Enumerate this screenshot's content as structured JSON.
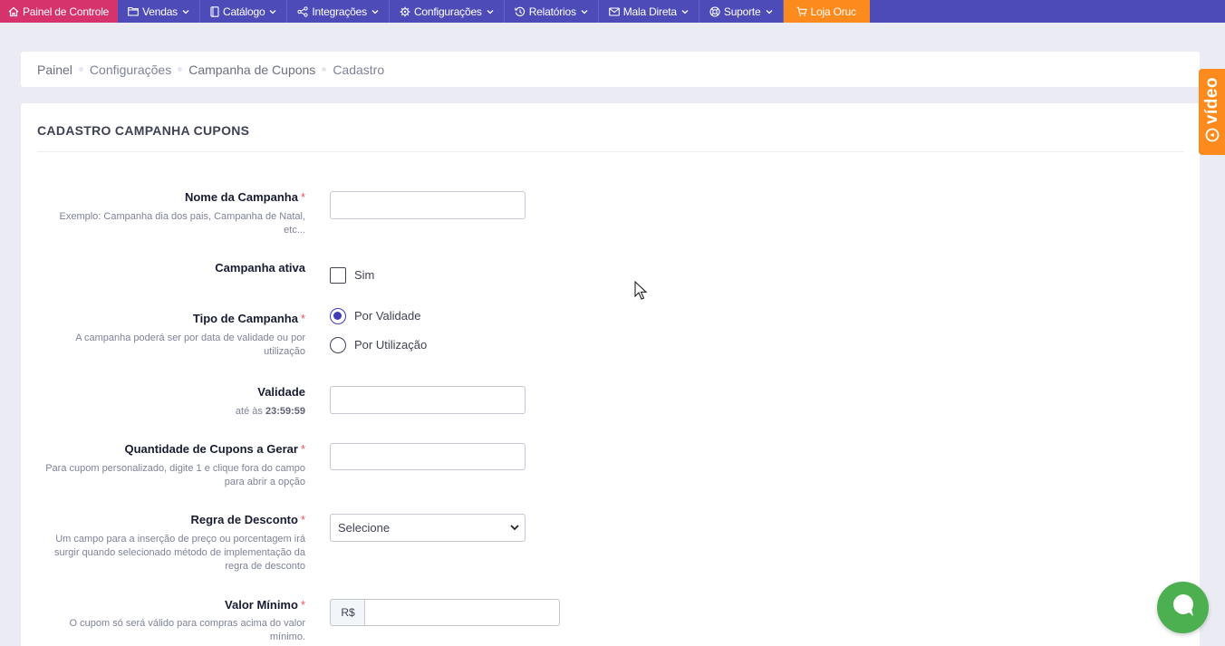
{
  "nav": {
    "items": [
      {
        "label": "Painel de Controle",
        "icon": "home-icon",
        "dropdown": false
      },
      {
        "label": "Vendas",
        "icon": "folder-icon",
        "dropdown": true
      },
      {
        "label": "Catálogo",
        "icon": "book-icon",
        "dropdown": true
      },
      {
        "label": "Integrações",
        "icon": "share-icon",
        "dropdown": true
      },
      {
        "label": "Configurações",
        "icon": "gear-icon",
        "dropdown": true
      },
      {
        "label": "Relatórios",
        "icon": "history-icon",
        "dropdown": true
      },
      {
        "label": "Mala Direta",
        "icon": "envelope-icon",
        "dropdown": true
      },
      {
        "label": "Suporte",
        "icon": "lifebuoy-icon",
        "dropdown": true
      },
      {
        "label": "Loja Oruc",
        "icon": "cart-icon",
        "dropdown": false
      }
    ],
    "colors": {
      "bar": "#4d4bb8",
      "home": "#d6336c",
      "store": "#fd8a1c"
    }
  },
  "breadcrumb": [
    "Painel",
    "Configurações",
    "Campanha de Cupons",
    "Cadastro"
  ],
  "card": {
    "title": "CADASTRO CAMPANHA CUPONS"
  },
  "form": {
    "nome": {
      "label": "Nome da Campanha",
      "required": "*",
      "hint": "Exemplo: Campanha dia dos pais, Campanha de Natal, etc...",
      "value": ""
    },
    "ativa": {
      "label": "Campanha ativa",
      "option": "Sim",
      "checked": false
    },
    "tipo": {
      "label": "Tipo de Campanha",
      "required": "*",
      "hint": "A campanha poderá ser por data de validade ou por utilização",
      "options": [
        "Por Validade",
        "Por Utilização"
      ],
      "selected": "Por Validade"
    },
    "validade": {
      "label": "Validade",
      "hint_prefix": "até às",
      "hint_time": "23:59:59",
      "value": ""
    },
    "quantidade": {
      "label": "Quantidade de Cupons a Gerar",
      "required": "*",
      "hint": "Para cupom personalizado, digite 1 e clique fora do campo para abrir a opção",
      "value": ""
    },
    "regra": {
      "label": "Regra de Desconto",
      "required": "*",
      "hint": "Um campo para a inserção de preço ou porcentagem irá surgir quando selecionado método de implementação da regra de desconto",
      "selected": "Selecione"
    },
    "valor_minimo": {
      "label": "Valor Mínimo",
      "required": "*",
      "hint": "O cupom só será válido para compras acima do valor mínimo.",
      "prefix": "R$",
      "value": ""
    }
  },
  "video_tab": {
    "label": "vídeo"
  },
  "chat": {
    "icon": "chat-icon"
  }
}
